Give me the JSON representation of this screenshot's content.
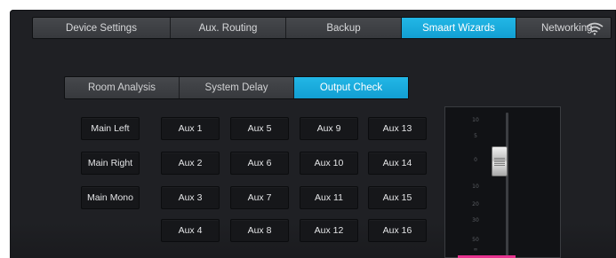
{
  "top_tabs": [
    {
      "label": "Device Settings",
      "active": false
    },
    {
      "label": "Aux. Routing",
      "active": false
    },
    {
      "label": "Backup",
      "active": false
    },
    {
      "label": "Smaart Wizards",
      "active": true
    },
    {
      "label": "Networking",
      "active": false
    }
  ],
  "sub_tabs": [
    {
      "label": "Room Analysis",
      "active": false
    },
    {
      "label": "System Delay",
      "active": false
    },
    {
      "label": "Output Check",
      "active": true
    }
  ],
  "outputs": {
    "main": [
      "Main Left",
      "Main Right",
      "Main Mono"
    ],
    "aux": [
      "Aux 1",
      "Aux 2",
      "Aux 3",
      "Aux 4",
      "Aux 5",
      "Aux 6",
      "Aux 7",
      "Aux 8",
      "Aux 9",
      "Aux 10",
      "Aux 11",
      "Aux 12",
      "Aux 13",
      "Aux 14",
      "Aux 15",
      "Aux 16"
    ]
  },
  "fader": {
    "scale": [
      "10",
      "5",
      "0",
      "10",
      "20",
      "30",
      "50",
      "∞"
    ],
    "icon": "fader-knob"
  },
  "colors": {
    "accent": "#1aa9dc",
    "panel": "#1f2024",
    "button": "#16171a"
  }
}
